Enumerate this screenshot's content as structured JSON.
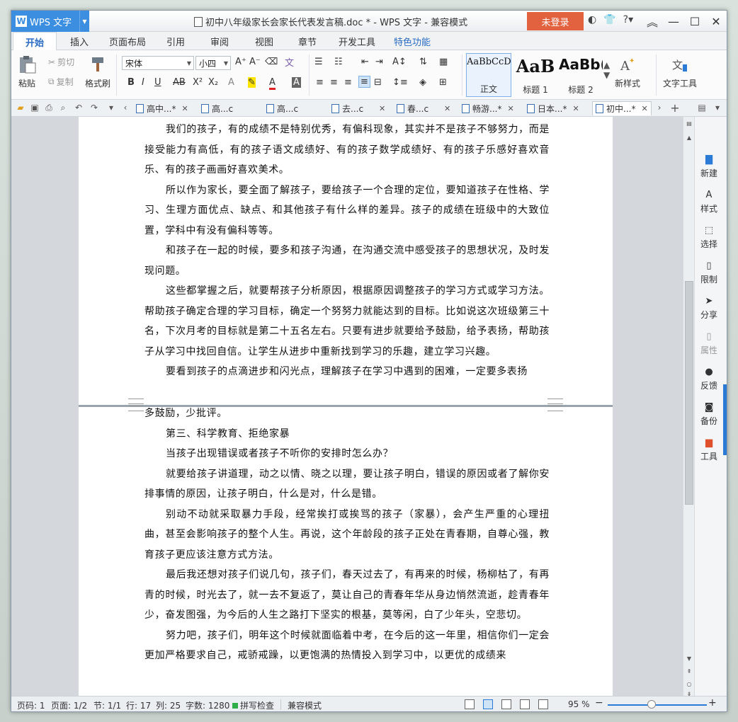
{
  "window": {
    "app_button": "WPS 文字",
    "title": "初中八年级家长会家长代表发言稿.doc * - WPS 文字 - 兼容模式",
    "login": "未登录"
  },
  "ribbon_tabs": [
    "开始",
    "插入",
    "页面布局",
    "引用",
    "审阅",
    "视图",
    "章节",
    "开发工具",
    "特色功能"
  ],
  "ribbon": {
    "paste": "粘贴",
    "cut": "剪切",
    "copy": "复制",
    "format_painter": "格式刷",
    "font_name": "宋体",
    "font_size": "小四",
    "styles": [
      {
        "sample": "AaBbCcD",
        "label": "正文"
      },
      {
        "sample": "AaB",
        "label": "标题 1"
      },
      {
        "sample": "AaBb(",
        "label": "标题 2"
      }
    ],
    "new_style": "新样式",
    "text_tools": "文字工具"
  },
  "doc_tabs": [
    {
      "label": "高中...*",
      "active": false
    },
    {
      "label": "高...c",
      "active": false
    },
    {
      "label": "高...c",
      "active": false
    },
    {
      "label": "去...c",
      "active": false
    },
    {
      "label": "春...c",
      "active": false
    },
    {
      "label": "畅游...*",
      "active": false
    },
    {
      "label": "日本...*",
      "active": false
    },
    {
      "label": "初中...*",
      "active": true
    }
  ],
  "page1_paragraphs": [
    {
      "text": "我们的孩子，有的成绩不是特别优秀，有偏科现象，其实并不是孩子不够努力，而是接受能力有高低，有的孩子语文成绩好、有的孩子数学成绩好、有的孩子乐感好喜欢音乐、有的孩子画画好喜欢美术。"
    },
    {
      "text": "所以作为家长，要全面了解孩子，要给孩子一个合理的定位，要知道孩子在性格、学习、生理方面优点、缺点、和其他孩子有什么样的差异。孩子的成绩在班级中的大致位置，学科中有没有偏科等等。"
    },
    {
      "text": "和孩子在一起的时候，要多和孩子沟通，在沟通交流中感受孩子的思想状况，及时发现问题。"
    },
    {
      "text": "这些都掌握之后，就要帮孩子分析原因，根据原因调整孩子的学习方式或学习方法。帮助孩子确定合理的学习目标，确定一个努努力就能达到的目标。比如说这次班级第三十名，下次月考的目标就是第二十五名左右。只要有进步就要给予鼓励，给予表扬，帮助孩子从学习中找回自信。让学生从进步中重新找到学习的乐趣，建立学习兴趣。"
    },
    {
      "text": "要看到孩子的点滴进步和闪光点，理解孩子在学习中遇到的困难，一定要多表扬"
    }
  ],
  "page2_paragraphs": [
    {
      "text": "多鼓励，少批评。",
      "indent": false
    },
    {
      "text": "第三、科学教育、拒绝家暴",
      "indent": true
    },
    {
      "text": "当孩子出现错误或者孩子不听你的安排时怎么办？",
      "indent": true
    },
    {
      "text": "就要给孩子讲道理，动之以情、晓之以理，要让孩子明白，错误的原因或者了解你安排事情的原因，让孩子明白，什么是对，什么是错。",
      "indent": true
    },
    {
      "text": "别动不动就采取暴力手段，经常挨打或挨骂的孩子（家暴），会产生严重的心理扭曲，甚至会影响孩子的整个人生。再说，这个年龄段的孩子正处在青春期，自尊心强，教育孩子更应该注意方式方法。",
      "indent": true
    },
    {
      "text": "最后我还想对孩子们说几句，孩子们，春天过去了，有再来的时候，杨柳枯了，有再青的时候，时光去了，就一去不复返了，莫让自己的青春年华从身边悄然流逝，趁青春年少，奋发图强，为今后的人生之路打下坚实的根基，莫等闲，白了少年头，空悲切。",
      "indent": true
    },
    {
      "text": "努力吧，孩子们，明年这个时候就面临着中考，在今后的这一年里，相信你们一定会更加严格要求自己，戒骄戒躁，以更饱满的热情投入到学习中，以更优的成绩来",
      "indent": true
    }
  ],
  "side_panel": [
    "新建",
    "样式",
    "选择",
    "限制",
    "分享",
    "属性",
    "反馈",
    "备份",
    "工具"
  ],
  "status": {
    "page_code": "页码: 1",
    "pages": "页面: 1/2",
    "section": "节: 1/1",
    "row": "行: 17",
    "col": "列: 25",
    "words": "字数: 1280",
    "spell": "拼写检查",
    "compat": "兼容模式",
    "zoom": "95 %"
  }
}
